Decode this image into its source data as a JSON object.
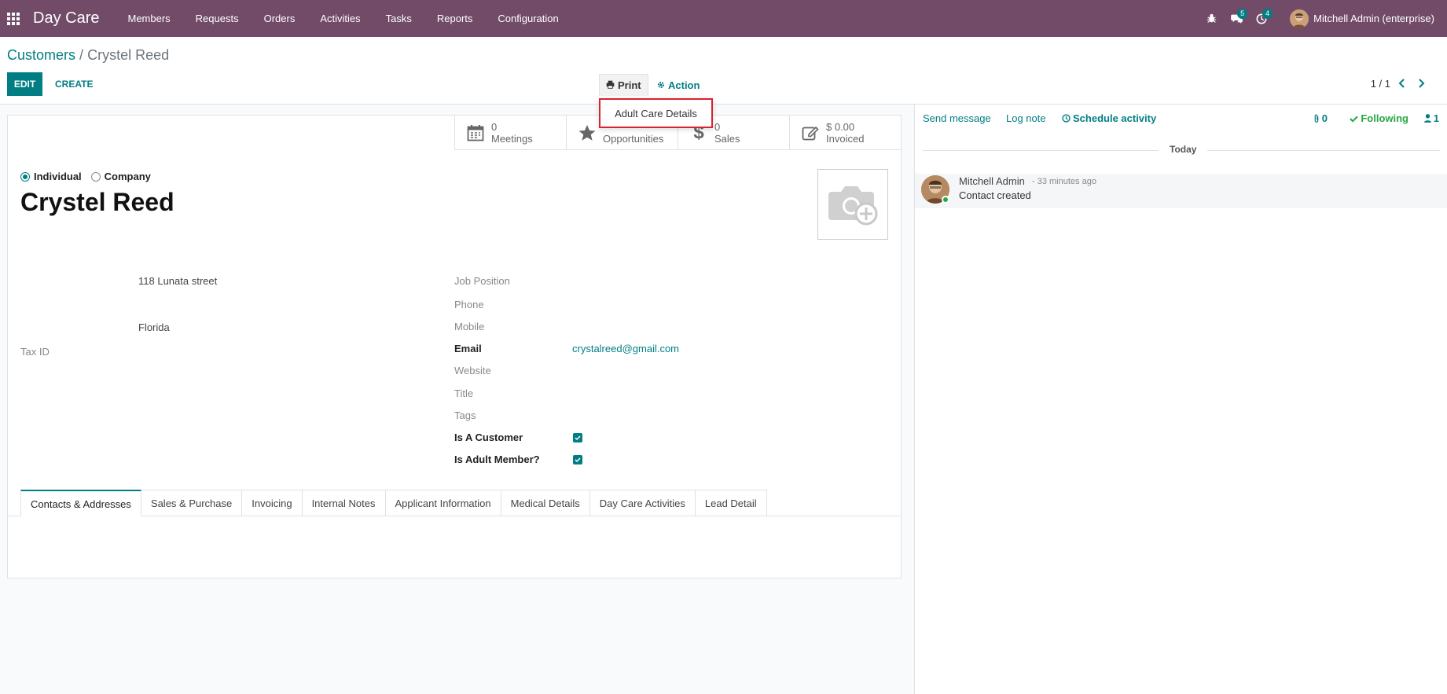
{
  "navbar": {
    "brand": "Day Care",
    "menu": [
      "Members",
      "Requests",
      "Orders",
      "Activities",
      "Tasks",
      "Reports",
      "Configuration"
    ],
    "messages_badge": "5",
    "activities_badge": "4",
    "user_name": "Mitchell Admin (enterprise)"
  },
  "breadcrumb": {
    "parent": "Customers",
    "separator": "/",
    "current": "Crystel Reed"
  },
  "toolbar": {
    "edit_label": "EDIT",
    "create_label": "CREATE",
    "print_label": "Print",
    "action_label": "Action",
    "print_menu_item": "Adult Care Details",
    "pager": "1 / 1"
  },
  "stat_buttons": [
    {
      "value": "0",
      "label": "Meetings"
    },
    {
      "value": "",
      "label": "Opportunities"
    },
    {
      "value": "0",
      "label": "Sales"
    },
    {
      "value": "$ 0.00",
      "label": "Invoiced"
    }
  ],
  "form": {
    "type_options": [
      "Individual",
      "Company"
    ],
    "selected_type": "Individual",
    "name": "Crystel Reed",
    "street": "118 Lunata street",
    "state": "Florida",
    "tax_id_label": "Tax ID",
    "fields": {
      "job_position": "Job Position",
      "phone": "Phone",
      "mobile": "Mobile",
      "email_label": "Email",
      "email_value": "crystalreed@gmail.com",
      "website": "Website",
      "title": "Title",
      "tags": "Tags",
      "is_customer": "Is A Customer",
      "is_adult_member": "Is Adult Member?"
    },
    "is_customer_checked": true,
    "is_adult_member_checked": true,
    "tabs": [
      "Contacts & Addresses",
      "Sales & Purchase",
      "Invoicing",
      "Internal Notes",
      "Applicant Information",
      "Medical Details",
      "Day Care Activities",
      "Lead Detail"
    ],
    "active_tab": "Contacts & Addresses"
  },
  "chatter": {
    "send_message": "Send message",
    "log_note": "Log note",
    "schedule_activity": "Schedule activity",
    "attachments_count": "0",
    "following": "Following",
    "followers_count": "1",
    "date_separator": "Today",
    "message": {
      "author": "Mitchell Admin",
      "time": "- 33 minutes ago",
      "body": "Contact created"
    }
  },
  "colors": {
    "navbar": "#714b67",
    "primary": "#017e84",
    "following": "#28a745",
    "dropdown_highlight": "#d9232e"
  }
}
